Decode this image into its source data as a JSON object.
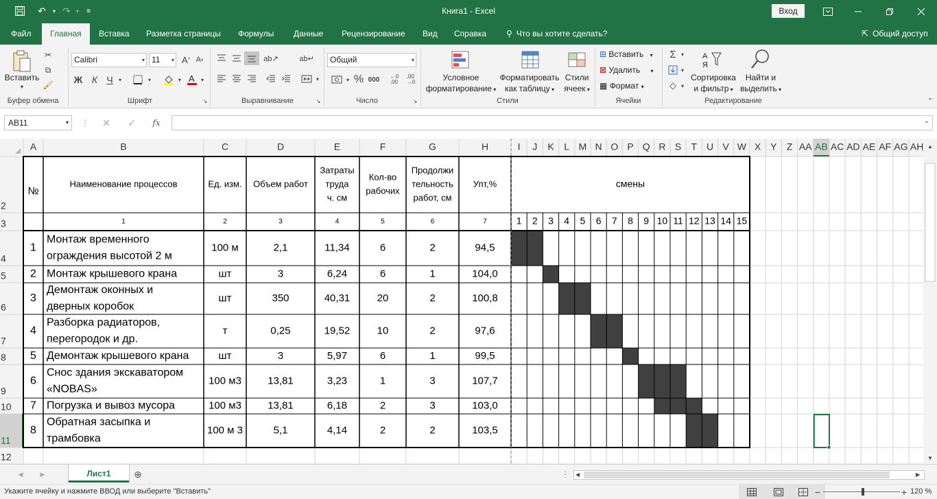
{
  "app": {
    "title": "Книга1  -  Excel",
    "sign_in": "Вход"
  },
  "tabs": [
    "Файл",
    "Главная",
    "Вставка",
    "Разметка страницы",
    "Формулы",
    "Данные",
    "Рецензирование",
    "Вид",
    "Справка"
  ],
  "tell_me": "Что вы хотите сделать?",
  "share": "Общий доступ",
  "ribbon": {
    "paste": "Вставить",
    "font_name": "Calibri",
    "font_size": "11",
    "bold": "Ж",
    "italic": "К",
    "underline": "Ч",
    "number_format": "Общий",
    "cond_format_1": "Условное",
    "cond_format_2": "форматирование",
    "format_table_1": "Форматировать",
    "format_table_2": "как таблицу",
    "cell_styles_1": "Стили",
    "cell_styles_2": "ячеек",
    "insert": "Вставить",
    "delete": "Удалить",
    "format": "Формат",
    "sort_1": "Сортировка",
    "sort_2": "и фильтр",
    "find_1": "Найти и",
    "find_2": "выделить",
    "groups": {
      "clipboard": "Буфер обмена",
      "font": "Шрифт",
      "alignment": "Выравнивание",
      "number": "Число",
      "styles": "Стили",
      "cells": "Ячейки",
      "editing": "Редактирование"
    }
  },
  "formula_bar": {
    "name_box": "AB11",
    "formula": ""
  },
  "grid": {
    "columns": [
      "A",
      "B",
      "C",
      "D",
      "E",
      "F",
      "G",
      "H",
      "I",
      "J",
      "K",
      "L",
      "M",
      "N",
      "O",
      "P",
      "Q",
      "R",
      "S",
      "T",
      "U",
      "V",
      "W",
      "X",
      "Y",
      "Z",
      "AA",
      "AB",
      "AC",
      "AD",
      "AE",
      "AF",
      "AG",
      "AH"
    ],
    "rows": [
      "2",
      "3",
      "4",
      "5",
      "6",
      "7",
      "8",
      "9",
      "10",
      "11",
      "12"
    ],
    "header_row": {
      "no": "№",
      "name": "Наименование процессов",
      "unit": "Ед. изм.",
      "volume": "Объем работ",
      "labor": [
        "Затраты",
        "труда",
        "ч. см"
      ],
      "workers": [
        "Кол-во",
        "рабочих"
      ],
      "duration": [
        "Продолжи",
        "тельность",
        "работ, см"
      ],
      "upt": "Упт,%",
      "shifts": "смены"
    },
    "index_row": [
      "1",
      "2",
      "3",
      "4",
      "5",
      "6",
      "7"
    ],
    "shift_numbers": [
      "1",
      "2",
      "3",
      "4",
      "5",
      "6",
      "7",
      "8",
      "9",
      "10",
      "11",
      "12",
      "13",
      "14",
      "15"
    ],
    "data_rows": [
      {
        "no": "1",
        "name": [
          "Монтаж временного",
          "ограждения высотой 2 м"
        ],
        "unit": "100 м",
        "volume": "2,1",
        "labor": "11,34",
        "workers": "6",
        "duration": "2",
        "upt": "94,5",
        "shifts": [
          1,
          2
        ]
      },
      {
        "no": "2",
        "name": [
          "Монтаж крышевого крана"
        ],
        "unit": "шт",
        "volume": "3",
        "labor": "6,24",
        "workers": "6",
        "duration": "1",
        "upt": "104,0",
        "shifts": [
          3
        ]
      },
      {
        "no": "3",
        "name": [
          "Демонтаж оконных и",
          "дверных коробок"
        ],
        "unit": "шт",
        "volume": "350",
        "labor": "40,31",
        "workers": "20",
        "duration": "2",
        "upt": "100,8",
        "shifts": [
          4,
          5
        ]
      },
      {
        "no": "4",
        "name": [
          "Разборка радиаторов,",
          "перегородок и др."
        ],
        "unit": "т",
        "volume": "0,25",
        "labor": "19,52",
        "workers": "10",
        "duration": "2",
        "upt": "97,6",
        "shifts": [
          6,
          7
        ]
      },
      {
        "no": "5",
        "name": [
          "Демонтаж крышевого крана"
        ],
        "unit": "шт",
        "volume": "3",
        "labor": "5,97",
        "workers": "6",
        "duration": "1",
        "upt": "99,5",
        "shifts": [
          8
        ]
      },
      {
        "no": "6",
        "name": [
          "Снос здания экскаватором",
          "«NOBAS»"
        ],
        "unit": "100 м3",
        "volume": "13,81",
        "labor": "3,23",
        "workers": "1",
        "duration": "3",
        "upt": "107,7",
        "shifts": [
          9,
          10,
          11
        ]
      },
      {
        "no": "7",
        "name": [
          "Погрузка и вывоз мусора"
        ],
        "unit": "100 м3",
        "volume": "13,81",
        "labor": "6,18",
        "workers": "2",
        "duration": "3",
        "upt": "103,0",
        "shifts": [
          10,
          11,
          12
        ]
      },
      {
        "no": "8",
        "name": [
          "Обратная засыпка и",
          "трамбовка"
        ],
        "unit": "100 м 3",
        "volume": "5,1",
        "labor": "4,14",
        "workers": "2",
        "duration": "2",
        "upt": "103,5",
        "shifts": [
          12,
          13
        ]
      }
    ]
  },
  "sheet_tab": "Лист1",
  "status": {
    "message": "Укажите ячейку и нажмите ВВОД или выберите \"Вставить\"",
    "zoom": "120 %"
  },
  "colors": {
    "excel_green": "#217346",
    "filled_cell": "#404040",
    "gridline": "#d4d4d4"
  }
}
